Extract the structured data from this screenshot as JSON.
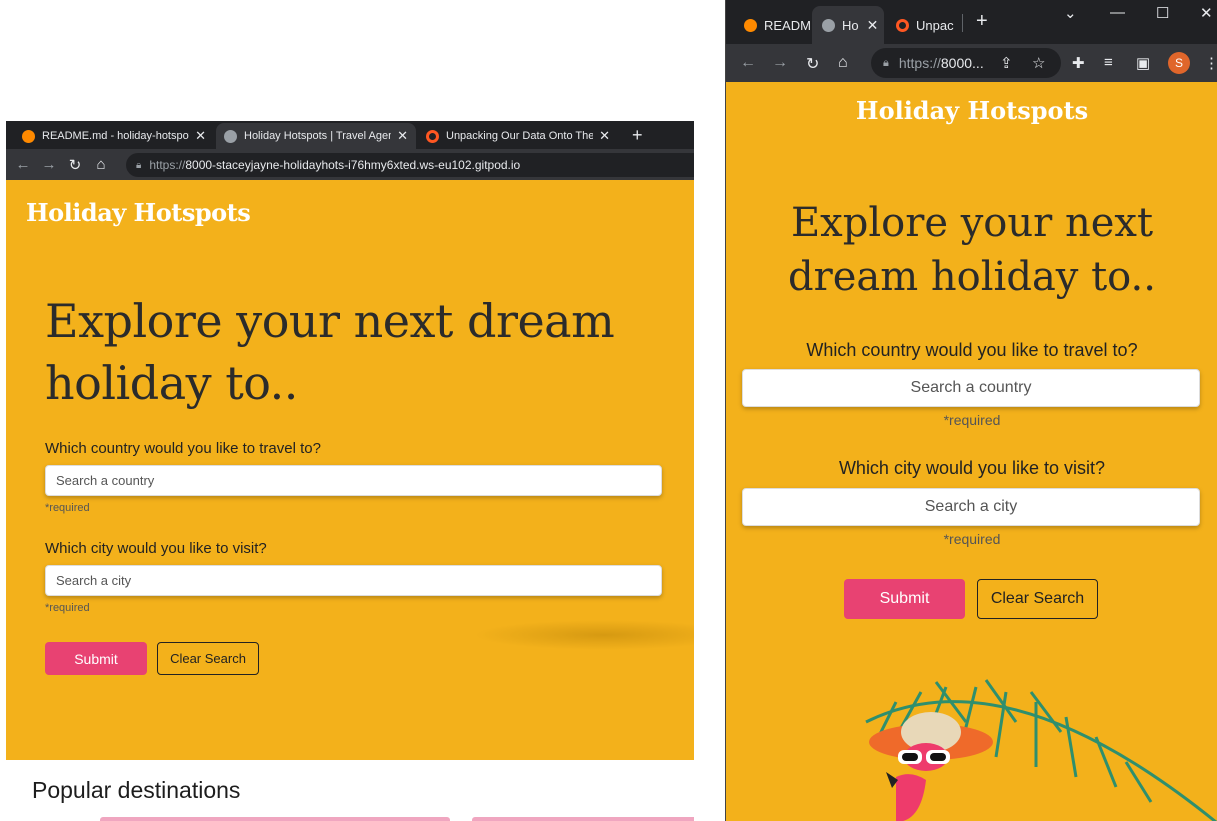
{
  "left": {
    "tabs": [
      {
        "title": "README.md - holiday-hotspots -",
        "close": "✕",
        "icon": "gitpod-icon"
      },
      {
        "title": "Holiday Hotspots | Travel Agency",
        "close": "✕",
        "icon": "globe-icon"
      },
      {
        "title": "Unpacking Our Data Onto The DO",
        "close": "✕",
        "icon": "ring-icon"
      }
    ],
    "new_tab": "+",
    "url_proto": "https://",
    "url_rest": "8000-staceyjayne-holidayhots-i76hmy6xted.ws-eu102.gitpod.io",
    "brand": "Holiday Hotspots",
    "hero": "Explore your next dream holiday to..",
    "country_label": "Which country would you like to travel to?",
    "country_placeholder": "Search a country",
    "required": "*required",
    "city_label": "Which city would you like to visit?",
    "city_placeholder": "Search a city",
    "submit": "Submit",
    "clear": "Clear Search",
    "popular": "Popular destinations"
  },
  "right": {
    "tabs": [
      {
        "title": "READM",
        "icon": "gitpod-icon"
      },
      {
        "title": "Ho",
        "close": "✕",
        "icon": "globe-icon"
      },
      {
        "title": "Unpac",
        "icon": "ring-icon"
      }
    ],
    "new_tab": "+",
    "window_controls": [
      "⌄",
      "—",
      "☐",
      "✕"
    ],
    "url_proto": "https://",
    "url_rest": "8000...",
    "avatar": "S",
    "brand": "Holiday Hotspots",
    "hero": "Explore your next dream holiday to..",
    "country_label": "Which country would you like to travel to?",
    "country_placeholder": "Search a country",
    "required": "*required",
    "city_label": "Which city would you like to visit?",
    "city_placeholder": "Search a city",
    "submit": "Submit",
    "clear": "Clear Search"
  },
  "colors": {
    "page_bg": "#f3b11b",
    "submit_bg": "#e84272",
    "chrome_dark": "#202124"
  }
}
